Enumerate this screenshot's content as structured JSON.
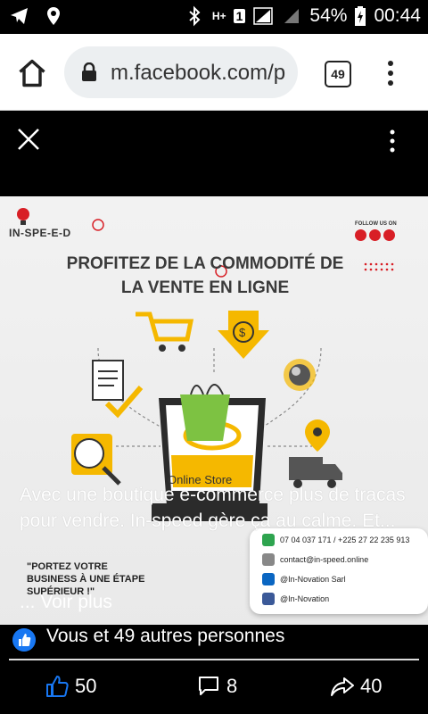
{
  "status_bar": {
    "battery": "54%",
    "time": "00:44",
    "network": "H+",
    "sim": "1"
  },
  "browser": {
    "url": "m.facebook.com/p",
    "tab_count": "49"
  },
  "ad": {
    "brand": "IN-SPE-E-D",
    "follow_label": "FOLLOW US ON",
    "headline_line1": "PROFITEZ DE LA COMMODITÉ DE",
    "headline_line2": "LA VENTE EN LIGNE",
    "store_label": "Online Store",
    "quote_line1": "\"PORTEZ VOTRE",
    "quote_line2": "BUSINESS À UNE ÉTAPE",
    "quote_line3": "SUPÉRIEUR !\"",
    "contacts": {
      "phone": "07 04 037 171 / +225 27 22 235 913",
      "email": "contact@in-speed.online",
      "linkedin": "@In-Novation Sarl",
      "social": "@In-Novation"
    },
    "colors": {
      "accent_yellow": "#f5b800",
      "brand_red": "#d81f26",
      "bag_green": "#7dc242"
    }
  },
  "caption": {
    "text": "Avec une boutique e-commerce plus de tracas pour vendre. In-speed gère ça au calme. Et...",
    "see_more": "... Voir plus"
  },
  "reactions": {
    "text": "Vous et 49 autres personnes"
  },
  "actions": {
    "likes": "50",
    "comments": "8",
    "shares": "40"
  }
}
